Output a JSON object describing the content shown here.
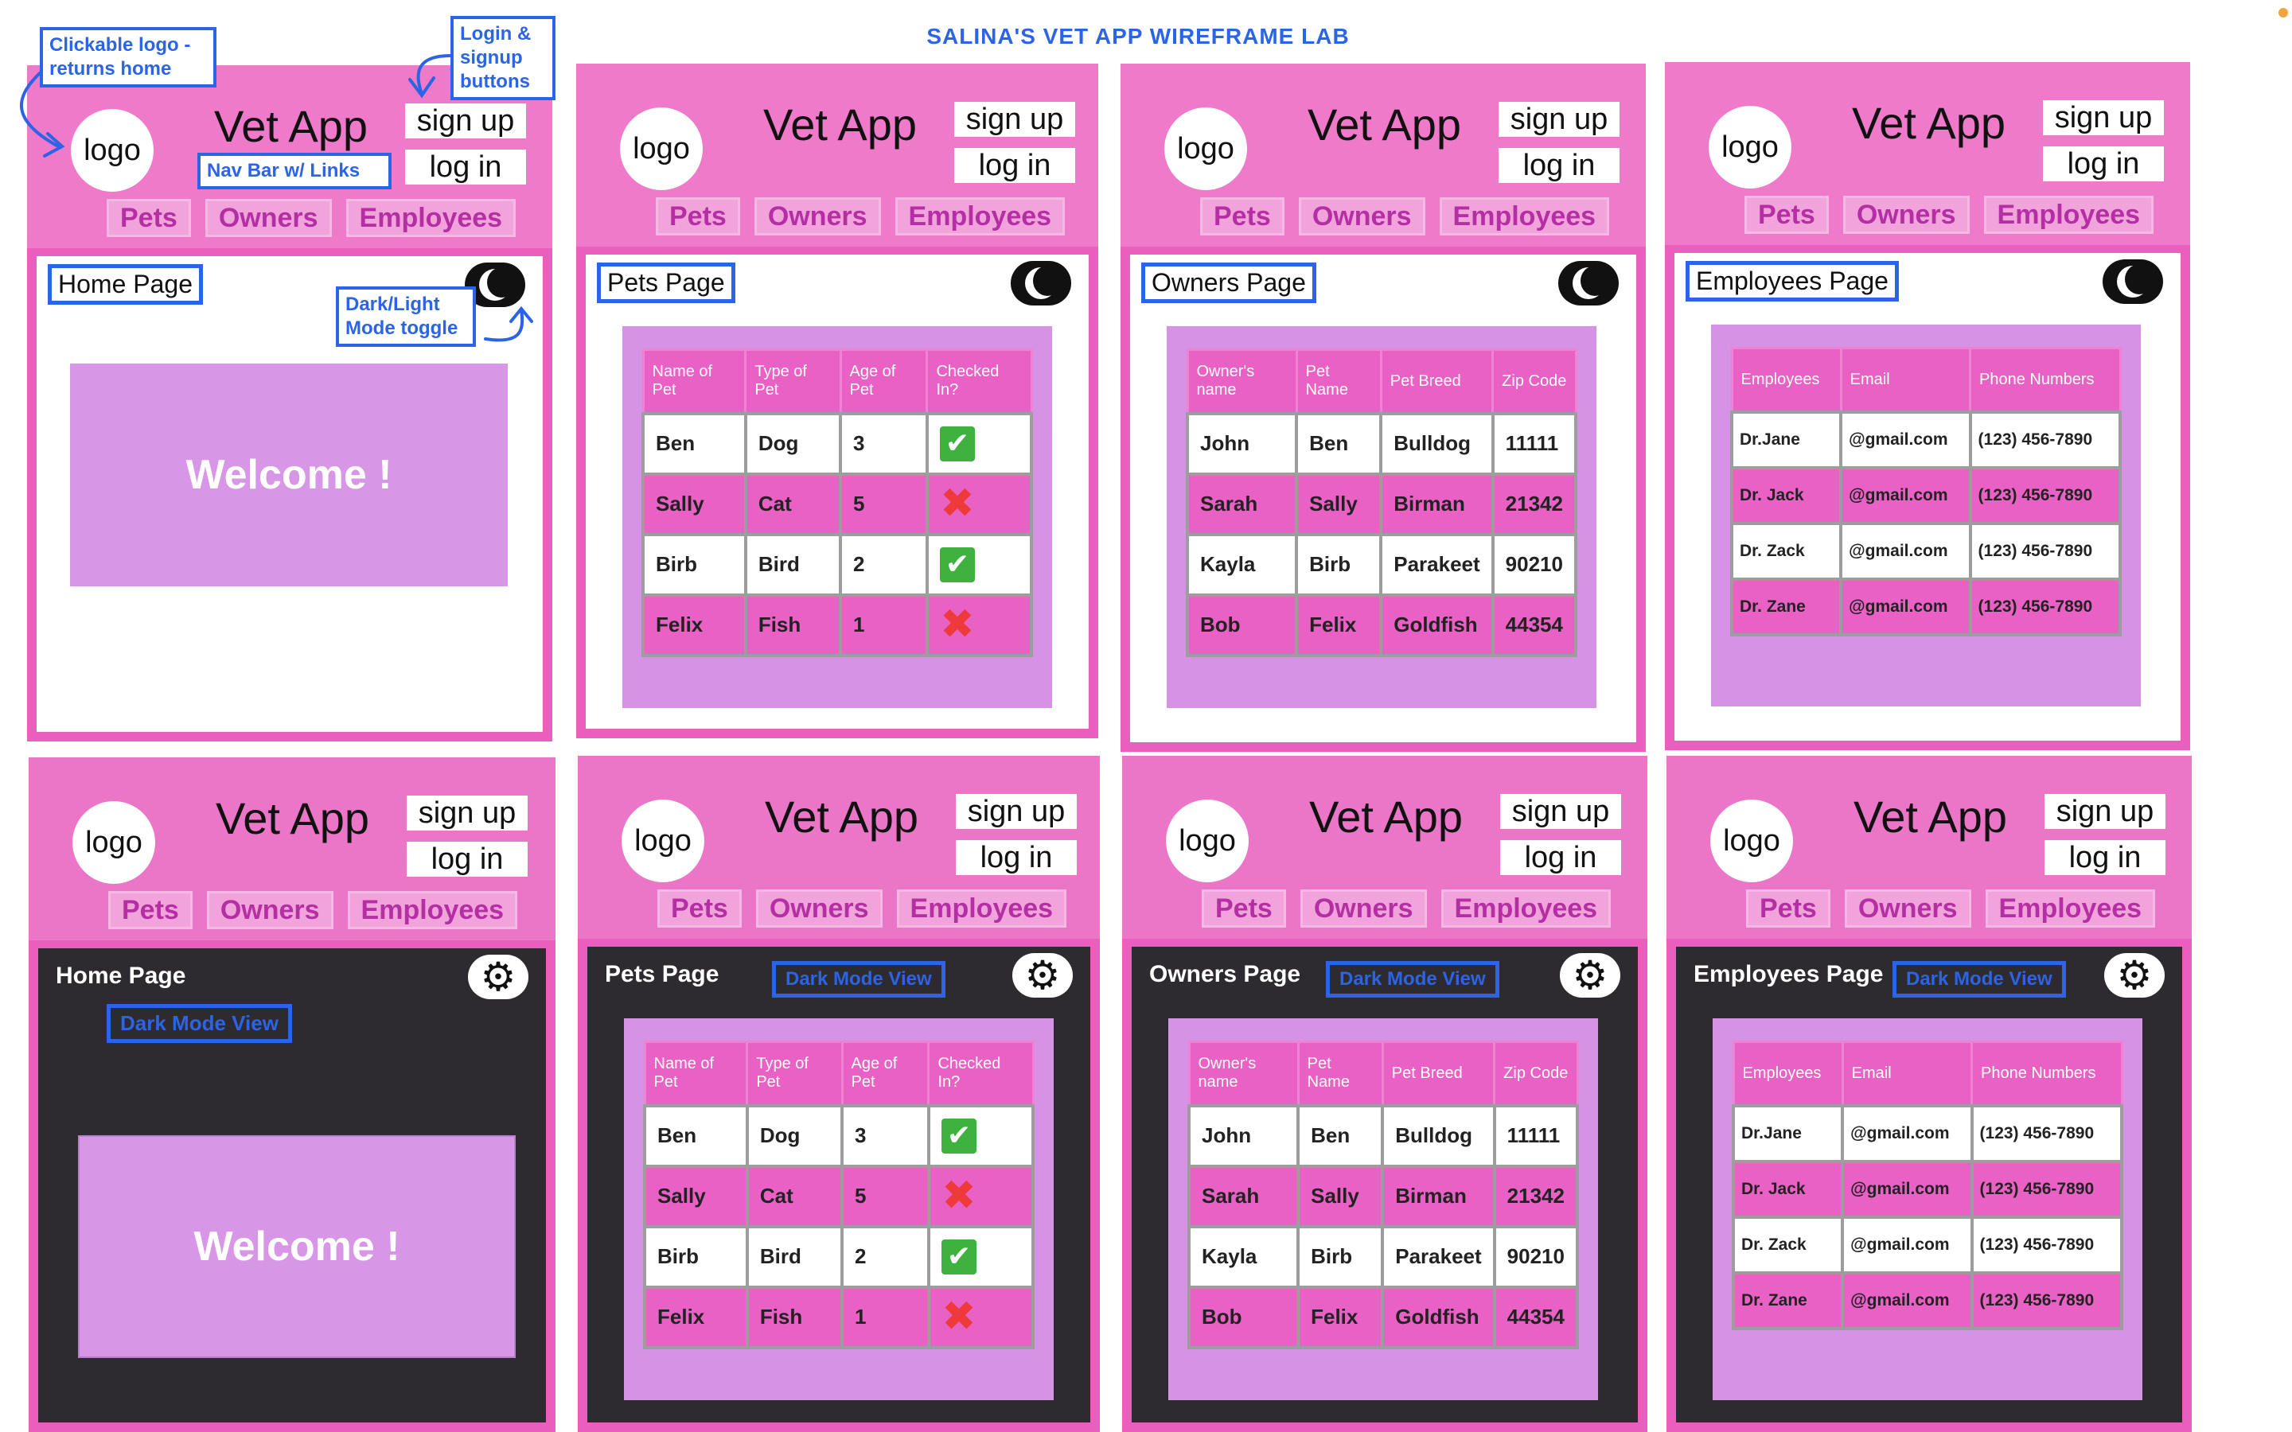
{
  "lab_title": "SALINA'S VET APP WIREFRAME LAB",
  "header": {
    "logo": "logo",
    "app_title": "Vet App",
    "sign_up": "sign up",
    "log_in": "log in",
    "nav": {
      "pets": "Pets",
      "owners": "Owners",
      "employees": "Employees"
    }
  },
  "pages": {
    "home": "Home Page",
    "pets": "Pets Page",
    "owners": "Owners Page",
    "employees": "Employees Page",
    "welcome": "Welcome !",
    "dark_mode_view": "Dark Mode View"
  },
  "annotations": {
    "logo_note": "Clickable logo - returns home",
    "auth_note": "Login & signup buttons",
    "nav_note": "Nav Bar w/ Links",
    "toggle_note": "Dark/Light Mode toggle"
  },
  "pets_table": {
    "headers": [
      "Name of Pet",
      "Type of Pet",
      "Age of Pet",
      "Checked In?"
    ],
    "rows": [
      {
        "name": "Ben",
        "type": "Dog",
        "age": "3",
        "checked_in": true
      },
      {
        "name": "Sally",
        "type": "Cat",
        "age": "5",
        "checked_in": false
      },
      {
        "name": "Birb",
        "type": "Bird",
        "age": "2",
        "checked_in": true
      },
      {
        "name": "Felix",
        "type": "Fish",
        "age": "1",
        "checked_in": false
      }
    ]
  },
  "owners_table": {
    "headers": [
      "Owner's name",
      "Pet Name",
      "Pet Breed",
      "Zip Code"
    ],
    "rows": [
      {
        "owner": "John",
        "pet": "Ben",
        "breed": "Bulldog",
        "zip": "11111"
      },
      {
        "owner": "Sarah",
        "pet": "Sally",
        "breed": "Birman",
        "zip": "21342"
      },
      {
        "owner": "Kayla",
        "pet": "Birb",
        "breed": "Parakeet",
        "zip": "90210"
      },
      {
        "owner": "Bob",
        "pet": "Felix",
        "breed": "Goldfish",
        "zip": "44354"
      }
    ]
  },
  "employees_table": {
    "headers": [
      "Employees",
      "Email",
      "Phone Numbers"
    ],
    "rows": [
      {
        "name": "Dr.Jane",
        "email": "@gmail.com",
        "phone": "(123) 456-7890"
      },
      {
        "name": "Dr. Jack",
        "email": "@gmail.com",
        "phone": "(123) 456-7890"
      },
      {
        "name": "Dr. Zack",
        "email": "@gmail.com",
        "phone": "(123) 456-7890"
      },
      {
        "name": "Dr. Zane",
        "email": "@gmail.com",
        "phone": "(123) 456-7890"
      }
    ]
  },
  "colors": {
    "annotation_blue": "#2b64e6",
    "header_pink": "#ee7ac9",
    "table_pink": "#ea61c5",
    "panel_purple": "#d693e6",
    "dark_bg": "#2e2b30"
  }
}
